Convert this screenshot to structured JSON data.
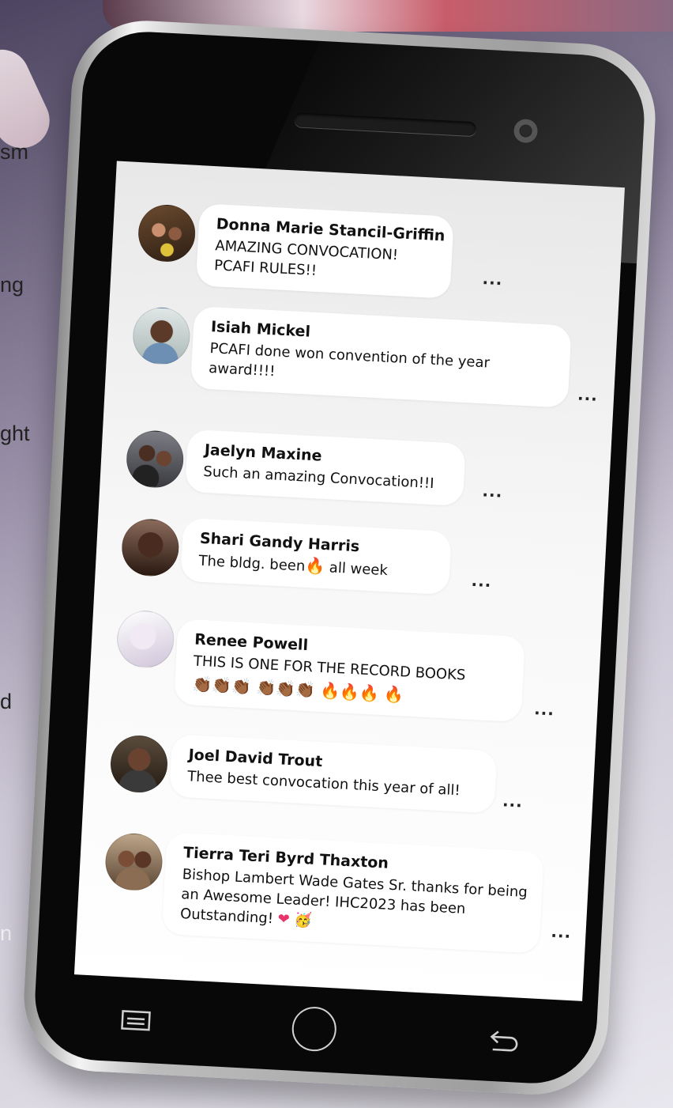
{
  "background": {
    "left_fragments": [
      "sm",
      "ng",
      "ght",
      "d",
      "n"
    ]
  },
  "comments": [
    {
      "name": "Donna Marie Stancil-Griffin",
      "text": "AMAZING CONVOCATION! PCAFI RULES!!",
      "more": "..."
    },
    {
      "name": "Isiah Mickel",
      "text": "PCAFI done won convention of the year award!!!!",
      "more": "..."
    },
    {
      "name": "Jaelyn Maxine",
      "text": "Such an amazing Convocation!!I",
      "more": "..."
    },
    {
      "name": "Shari Gandy Harris",
      "text_before": "The bldg. been",
      "emoji": "🔥",
      "text_after": " all week",
      "more": "..."
    },
    {
      "name": "Renee Powell",
      "text": "THIS IS ONE FOR THE RECORD BOOKS",
      "emoji_line": "👏🏾👏🏾👏🏾 👏🏾👏🏾👏🏾 🔥🔥🔥 🔥",
      "more": "..."
    },
    {
      "name": "Joel David Trout",
      "text": "Thee best convocation this year of all!",
      "more": "..."
    },
    {
      "name": "Tierra Teri Byrd Thaxton",
      "text": "Bishop Lambert Wade Gates Sr. thanks for being an Awesome Leader! IHC2023 has been Outstanding!",
      "emoji": "❤ 🥳",
      "more": "..."
    }
  ],
  "colors": {
    "screen_bg": "#f4f4f4",
    "bubble_bg": "#ffffff",
    "phone_body": "#080808",
    "accent_heart": "#e8336b",
    "fire": "#e8572a"
  },
  "icons": {
    "nav_left": "menu-icon",
    "nav_center": "home-icon",
    "nav_right": "back-icon"
  }
}
